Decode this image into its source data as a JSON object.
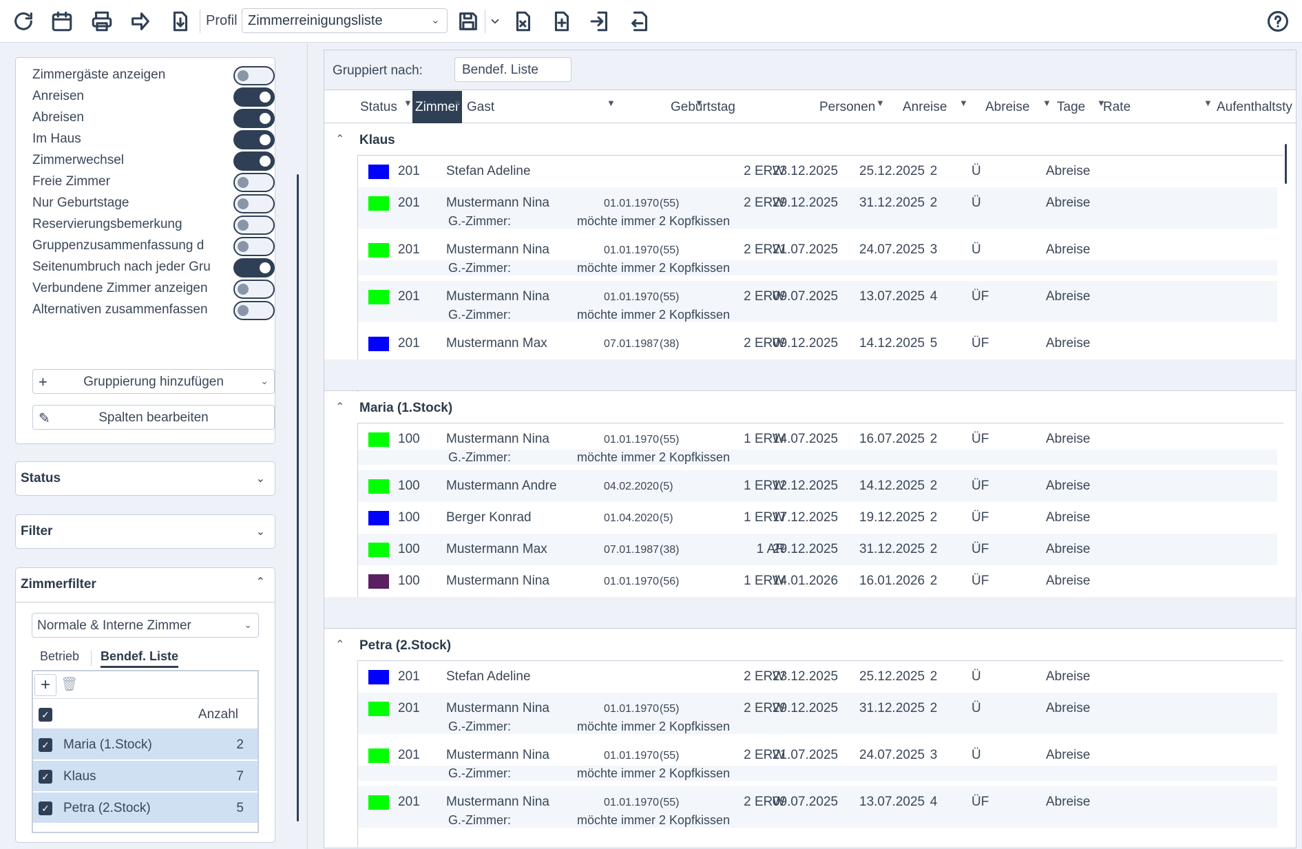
{
  "toolbar": {
    "icons": [
      "refresh-icon",
      "calendar-icon",
      "print-icon",
      "forward-icon",
      "download-icon",
      "save-icon",
      "export-excel-icon",
      "add-document-icon",
      "import-icon",
      "export-icon",
      "help-icon"
    ],
    "profil_label": "Profil",
    "profil_value": "Zimmerreinigungsliste"
  },
  "sidebar": {
    "toggles": [
      {
        "label": "Zimmergäste anzeigen",
        "on": false
      },
      {
        "label": "Anreisen",
        "on": true
      },
      {
        "label": "Abreisen",
        "on": true
      },
      {
        "label": "Im Haus",
        "on": true
      },
      {
        "label": "Zimmerwechsel",
        "on": true
      },
      {
        "label": "Freie Zimmer",
        "on": false
      },
      {
        "label": "Nur Geburtstage",
        "on": false
      },
      {
        "label": "Reservierungsbemerkung",
        "on": false
      },
      {
        "label": "Gruppenzusammenfassung d",
        "on": false
      },
      {
        "label": "Seitenumbruch nach jeder Gru",
        "on": true
      },
      {
        "label": "Verbundene Zimmer anzeigen",
        "on": false
      },
      {
        "label": "Alternativen zusammenfassen",
        "on": false
      }
    ],
    "add_grouping": "Gruppierung hinzufügen",
    "edit_columns": "Spalten bearbeiten",
    "status_title": "Status",
    "filter_title": "Filter",
    "roomfilter_title": "Zimmerfilter",
    "room_select": "Normale & Interne Zimmer",
    "tabs": [
      "Betrieb",
      "Bendef. Liste"
    ],
    "list_header": "Anzahl",
    "list_items": [
      {
        "name": "Maria (1.Stock)",
        "count": "2"
      },
      {
        "name": "Klaus",
        "count": "7"
      },
      {
        "name": "Petra (2.Stock)",
        "count": "5"
      }
    ]
  },
  "main": {
    "grouped_label": "Gruppiert nach:",
    "grouped_value": "Bendef. Liste",
    "columns": [
      "Status",
      "Zimmer",
      "Gast",
      "Geburtstag",
      "Personen",
      "Anreise",
      "Abreise",
      "Tage",
      "Rate",
      "Aufenthaltsty"
    ],
    "note_label": "G.-Zimmer:",
    "groups": [
      {
        "name": "Klaus",
        "rows": [
          {
            "color": "#0000ff",
            "room": "201",
            "guest": "Stefan Adeline",
            "bday": "",
            "age": "",
            "persons": "2 ERW",
            "arrival": "23.12.2025",
            "departure": "25.12.2025",
            "days": "2",
            "rate": "Ü",
            "type": "Abreise",
            "note": ""
          },
          {
            "color": "#00ff00",
            "room": "201",
            "guest": "Mustermann Nina",
            "bday": "01.01.1970",
            "age": "(55)",
            "persons": "2 ERW",
            "arrival": "29.12.2025",
            "departure": "31.12.2025",
            "days": "2",
            "rate": "Ü",
            "type": "Abreise",
            "note": "möchte immer 2 Kopfkissen"
          },
          {
            "color": "#00ff00",
            "room": "201",
            "guest": "Mustermann Nina",
            "bday": "01.01.1970",
            "age": "(55)",
            "persons": "2 ERW",
            "arrival": "21.07.2025",
            "departure": "24.07.2025",
            "days": "3",
            "rate": "Ü",
            "type": "Abreise",
            "note": "möchte immer 2 Kopfkissen"
          },
          {
            "color": "#00ff00",
            "room": "201",
            "guest": "Mustermann Nina",
            "bday": "01.01.1970",
            "age": "(55)",
            "persons": "2 ERW",
            "arrival": "09.07.2025",
            "departure": "13.07.2025",
            "days": "4",
            "rate": "ÜF",
            "type": "Abreise",
            "note": "möchte immer 2 Kopfkissen"
          },
          {
            "color": "#0000ff",
            "room": "201",
            "guest": "Mustermann Max",
            "bday": "07.01.1987",
            "age": "(38)",
            "persons": "2 ERW",
            "arrival": "09.12.2025",
            "departure": "14.12.2025",
            "days": "5",
            "rate": "ÜF",
            "type": "Abreise",
            "note": ""
          }
        ]
      },
      {
        "name": "Maria (1.Stock)",
        "rows": [
          {
            "color": "#00ff00",
            "room": "100",
            "guest": "Mustermann Nina",
            "bday": "01.01.1970",
            "age": "(55)",
            "persons": "1 ERW",
            "arrival": "14.07.2025",
            "departure": "16.07.2025",
            "days": "2",
            "rate": "ÜF",
            "type": "Abreise",
            "note": "möchte immer 2 Kopfkissen"
          },
          {
            "color": "#00ff00",
            "room": "100",
            "guest": "Mustermann Andre",
            "bday": "04.02.2020",
            "age": "(5)",
            "persons": "1 ERW",
            "arrival": "12.12.2025",
            "departure": "14.12.2025",
            "days": "2",
            "rate": "ÜF",
            "type": "Abreise",
            "note": ""
          },
          {
            "color": "#0000ff",
            "room": "100",
            "guest": "Berger Konrad",
            "bday": "01.04.2020",
            "age": "(5)",
            "persons": "1 ERW",
            "arrival": "17.12.2025",
            "departure": "19.12.2025",
            "days": "2",
            "rate": "ÜF",
            "type": "Abreise",
            "note": ""
          },
          {
            "color": "#00ff00",
            "room": "100",
            "guest": "Mustermann Max",
            "bday": "07.01.1987",
            "age": "(38)",
            "persons": "1 AR",
            "arrival": "29.12.2025",
            "departure": "31.12.2025",
            "days": "2",
            "rate": "ÜF",
            "type": "Abreise",
            "note": ""
          },
          {
            "color": "#5a2060",
            "room": "100",
            "guest": "Mustermann Nina",
            "bday": "01.01.1970",
            "age": "(56)",
            "persons": "1 ERW",
            "arrival": "14.01.2026",
            "departure": "16.01.2026",
            "days": "2",
            "rate": "ÜF",
            "type": "Abreise",
            "note": ""
          }
        ]
      },
      {
        "name": "Petra (2.Stock)",
        "rows": [
          {
            "color": "#0000ff",
            "room": "201",
            "guest": "Stefan Adeline",
            "bday": "",
            "age": "",
            "persons": "2 ERW",
            "arrival": "23.12.2025",
            "departure": "25.12.2025",
            "days": "2",
            "rate": "Ü",
            "type": "Abreise",
            "note": ""
          },
          {
            "color": "#00ff00",
            "room": "201",
            "guest": "Mustermann Nina",
            "bday": "01.01.1970",
            "age": "(55)",
            "persons": "2 ERW",
            "arrival": "29.12.2025",
            "departure": "31.12.2025",
            "days": "2",
            "rate": "Ü",
            "type": "Abreise",
            "note": "möchte immer 2 Kopfkissen"
          },
          {
            "color": "#00ff00",
            "room": "201",
            "guest": "Mustermann Nina",
            "bday": "01.01.1970",
            "age": "(55)",
            "persons": "2 ERW",
            "arrival": "21.07.2025",
            "departure": "24.07.2025",
            "days": "3",
            "rate": "Ü",
            "type": "Abreise",
            "note": "möchte immer 2 Kopfkissen"
          },
          {
            "color": "#00ff00",
            "room": "201",
            "guest": "Mustermann Nina",
            "bday": "01.01.1970",
            "age": "(55)",
            "persons": "2 ERW",
            "arrival": "09.07.2025",
            "departure": "13.07.2025",
            "days": "4",
            "rate": "ÜF",
            "type": "Abreise",
            "note": "möchte immer 2 Kopfkissen"
          }
        ]
      }
    ]
  }
}
